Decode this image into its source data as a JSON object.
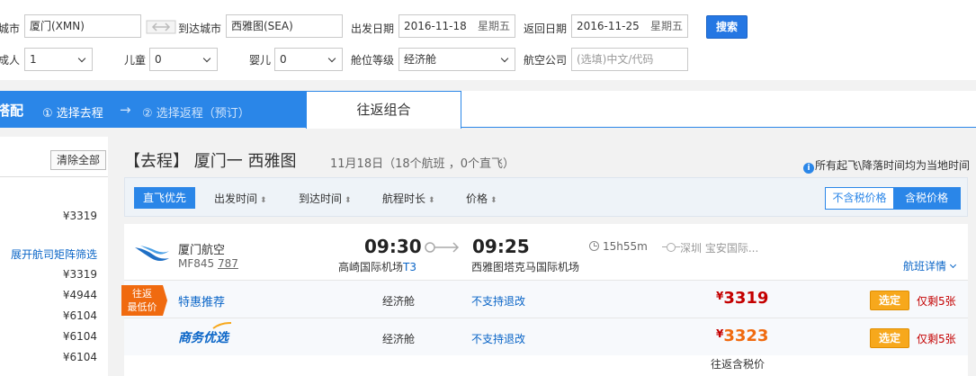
{
  "search": {
    "from_label": "城市",
    "from_value": "厦门(XMN)",
    "to_label": "到达城市",
    "to_value": "西雅图(SEA)",
    "depart_label": "出发日期",
    "depart_date": "2016-11-18",
    "depart_weekday": "星期五",
    "return_label": "返回日期",
    "return_date": "2016-11-25",
    "return_weekday": "星期五",
    "search_button": "搜索",
    "adult_label": "成人",
    "adult_value": "1",
    "child_label": "儿童",
    "child_value": "0",
    "infant_label": "婴儿",
    "infant_value": "0",
    "cabin_label": "舱位等级",
    "cabin_value": "经济舱",
    "airline_label": "航空公司",
    "airline_placeholder": "(选填)中文/代码"
  },
  "steps": {
    "partial_title": "搭配",
    "step1": "① 选择去程",
    "arrow": "→",
    "step2": "② 选择返程（预订）",
    "combo_tab": "往返组合"
  },
  "sidebar": {
    "clear_all": "清除全部",
    "prices_top": [
      "¥3319"
    ],
    "expand_link": "展开航司矩阵筛选",
    "prices": [
      "¥3319",
      "¥4944",
      "¥6104",
      "¥6104",
      "¥6104"
    ]
  },
  "main": {
    "title": "【去程】 厦门一 西雅图",
    "subtitle": "11月18日（18个航班 ，0个直飞）",
    "notice": "所有起飞\\降落时间均为当地时间"
  },
  "sort": {
    "direct_first": "直飞优先",
    "items": [
      "出发时间",
      "到达时间",
      "航程时长",
      "价格"
    ],
    "tax_excl": "不含税价格",
    "tax_incl": "含税价格"
  },
  "flight": {
    "airline": "厦门航空",
    "flight_no": "MF845",
    "aircraft": "787",
    "dep_time": "09:30",
    "arr_time": "09:25",
    "dep_airport": "高崎国际机场",
    "dep_terminal": "T3",
    "arr_airport": "西雅图塔克马国际机场",
    "duration": "15h55m",
    "stop": "深圳 宝安国际...",
    "detail_link": "航班详情",
    "rows": [
      {
        "badge_line1": "往返",
        "badge_line2": "最低价",
        "title": "特惠推荐",
        "cabin": "经济舱",
        "refund": "不支持退改",
        "currency": "¥",
        "price": "3319",
        "book": "选定",
        "remain": "仅剩5张"
      },
      {
        "title": "商务优选",
        "cabin": "经济舱",
        "refund": "不支持退改",
        "currency": "¥",
        "price": "3323",
        "book": "选定",
        "remain": "仅剩5张"
      }
    ],
    "round_tax_label": "往返含税价"
  }
}
